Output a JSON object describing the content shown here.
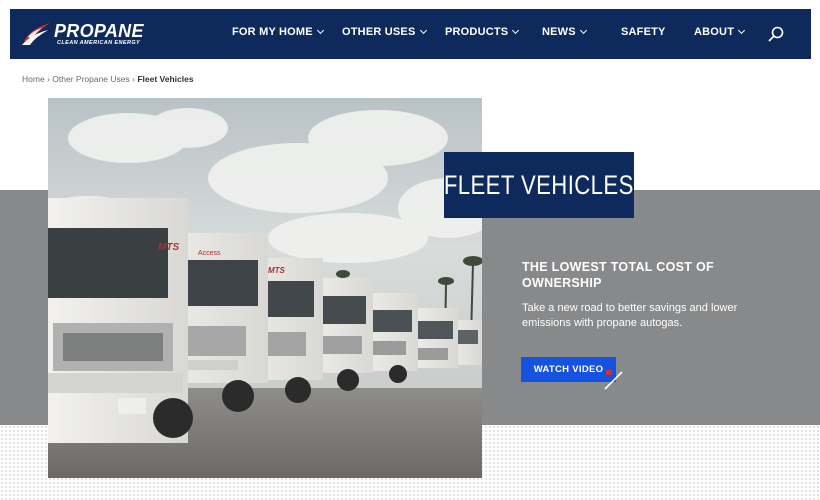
{
  "brand": {
    "name": "PROPANE",
    "tagline": "CLEAN AMERICAN ENERGY",
    "colors": {
      "navy": "#0e2a5c",
      "red": "#d32f2f",
      "button_blue": "#1652e0",
      "gray_band": "#88898b"
    }
  },
  "nav": {
    "items": [
      {
        "label": "FOR MY HOME",
        "has_dropdown": true
      },
      {
        "label": "OTHER USES",
        "has_dropdown": true
      },
      {
        "label": "PRODUCTS",
        "has_dropdown": true
      },
      {
        "label": "NEWS",
        "has_dropdown": true
      },
      {
        "label": "SAFETY",
        "has_dropdown": false
      },
      {
        "label": "ABOUT",
        "has_dropdown": true
      }
    ],
    "search_icon": "search-icon"
  },
  "breadcrumb": {
    "home": "Home",
    "parent": "Other Propane Uses",
    "separator": "›",
    "current": "Fleet Vehicles"
  },
  "hero": {
    "title": "FLEET VEHICLES",
    "image_bus_label": "MTS",
    "image_bus_text": "Access",
    "headline": "THE LOWEST TOTAL COST OF OWNERSHIP",
    "subtext": "Take a new road to better savings and lower emissions with propane autogas.",
    "cta_label": "WATCH VIDEO"
  }
}
